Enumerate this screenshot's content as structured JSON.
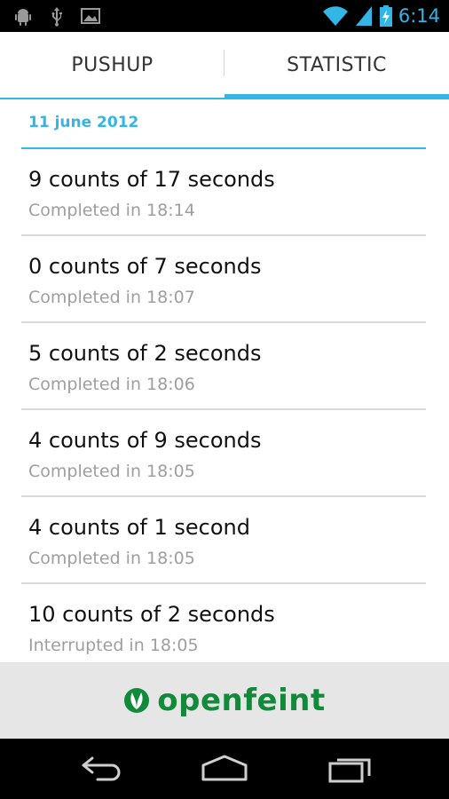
{
  "status_bar": {
    "time": "6:14",
    "icons": [
      "android-debug-icon",
      "usb-icon",
      "image-icon",
      "wifi-icon",
      "signal-icon",
      "battery-charging-icon"
    ]
  },
  "tabs": [
    {
      "label": "PUSHUP",
      "selected": false
    },
    {
      "label": "STATISTIC",
      "selected": true
    }
  ],
  "section": {
    "date": "11 june 2012"
  },
  "entries": [
    {
      "title": "9 counts of 17 seconds",
      "subtitle": "Completed in 18:14"
    },
    {
      "title": "0 counts of 7 seconds",
      "subtitle": "Completed in 18:07"
    },
    {
      "title": "5 counts of 2 seconds",
      "subtitle": "Completed in 18:06"
    },
    {
      "title": "4 counts of 9 seconds",
      "subtitle": "Completed in 18:05"
    },
    {
      "title": "4 counts of 1 second",
      "subtitle": "Completed in 18:05"
    },
    {
      "title": "10 counts of 2 seconds",
      "subtitle": "Interrupted in 18:05"
    }
  ],
  "ad": {
    "brand": "openfeint",
    "brand_color": "#118a3a"
  },
  "colors": {
    "accent": "#33b5e5",
    "divider": "#d9d9d9",
    "subtitle": "#9e9e9e"
  }
}
